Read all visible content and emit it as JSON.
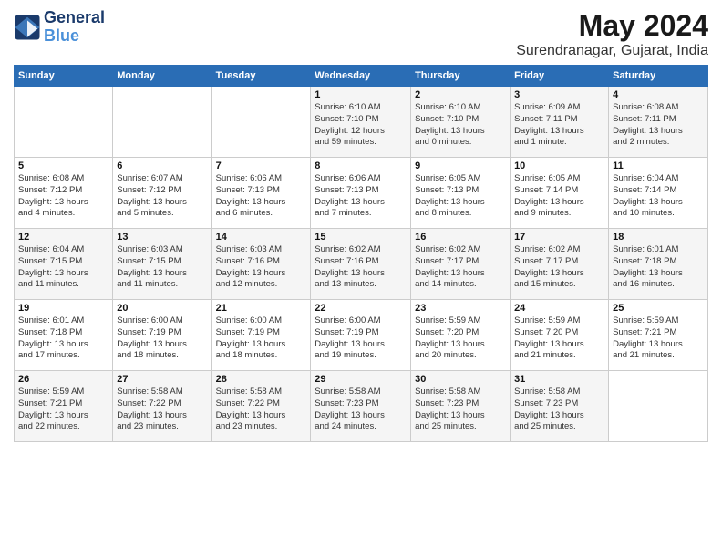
{
  "logo": {
    "line1": "General",
    "line2": "Blue"
  },
  "title": "May 2024",
  "location": "Surendranagar, Gujarat, India",
  "days_header": [
    "Sunday",
    "Monday",
    "Tuesday",
    "Wednesday",
    "Thursday",
    "Friday",
    "Saturday"
  ],
  "weeks": [
    [
      {
        "day": "",
        "info": ""
      },
      {
        "day": "",
        "info": ""
      },
      {
        "day": "",
        "info": ""
      },
      {
        "day": "1",
        "info": "Sunrise: 6:10 AM\nSunset: 7:10 PM\nDaylight: 12 hours\nand 59 minutes."
      },
      {
        "day": "2",
        "info": "Sunrise: 6:10 AM\nSunset: 7:10 PM\nDaylight: 13 hours\nand 0 minutes."
      },
      {
        "day": "3",
        "info": "Sunrise: 6:09 AM\nSunset: 7:11 PM\nDaylight: 13 hours\nand 1 minute."
      },
      {
        "day": "4",
        "info": "Sunrise: 6:08 AM\nSunset: 7:11 PM\nDaylight: 13 hours\nand 2 minutes."
      }
    ],
    [
      {
        "day": "5",
        "info": "Sunrise: 6:08 AM\nSunset: 7:12 PM\nDaylight: 13 hours\nand 4 minutes."
      },
      {
        "day": "6",
        "info": "Sunrise: 6:07 AM\nSunset: 7:12 PM\nDaylight: 13 hours\nand 5 minutes."
      },
      {
        "day": "7",
        "info": "Sunrise: 6:06 AM\nSunset: 7:13 PM\nDaylight: 13 hours\nand 6 minutes."
      },
      {
        "day": "8",
        "info": "Sunrise: 6:06 AM\nSunset: 7:13 PM\nDaylight: 13 hours\nand 7 minutes."
      },
      {
        "day": "9",
        "info": "Sunrise: 6:05 AM\nSunset: 7:13 PM\nDaylight: 13 hours\nand 8 minutes."
      },
      {
        "day": "10",
        "info": "Sunrise: 6:05 AM\nSunset: 7:14 PM\nDaylight: 13 hours\nand 9 minutes."
      },
      {
        "day": "11",
        "info": "Sunrise: 6:04 AM\nSunset: 7:14 PM\nDaylight: 13 hours\nand 10 minutes."
      }
    ],
    [
      {
        "day": "12",
        "info": "Sunrise: 6:04 AM\nSunset: 7:15 PM\nDaylight: 13 hours\nand 11 minutes."
      },
      {
        "day": "13",
        "info": "Sunrise: 6:03 AM\nSunset: 7:15 PM\nDaylight: 13 hours\nand 11 minutes."
      },
      {
        "day": "14",
        "info": "Sunrise: 6:03 AM\nSunset: 7:16 PM\nDaylight: 13 hours\nand 12 minutes."
      },
      {
        "day": "15",
        "info": "Sunrise: 6:02 AM\nSunset: 7:16 PM\nDaylight: 13 hours\nand 13 minutes."
      },
      {
        "day": "16",
        "info": "Sunrise: 6:02 AM\nSunset: 7:17 PM\nDaylight: 13 hours\nand 14 minutes."
      },
      {
        "day": "17",
        "info": "Sunrise: 6:02 AM\nSunset: 7:17 PM\nDaylight: 13 hours\nand 15 minutes."
      },
      {
        "day": "18",
        "info": "Sunrise: 6:01 AM\nSunset: 7:18 PM\nDaylight: 13 hours\nand 16 minutes."
      }
    ],
    [
      {
        "day": "19",
        "info": "Sunrise: 6:01 AM\nSunset: 7:18 PM\nDaylight: 13 hours\nand 17 minutes."
      },
      {
        "day": "20",
        "info": "Sunrise: 6:00 AM\nSunset: 7:19 PM\nDaylight: 13 hours\nand 18 minutes."
      },
      {
        "day": "21",
        "info": "Sunrise: 6:00 AM\nSunset: 7:19 PM\nDaylight: 13 hours\nand 18 minutes."
      },
      {
        "day": "22",
        "info": "Sunrise: 6:00 AM\nSunset: 7:19 PM\nDaylight: 13 hours\nand 19 minutes."
      },
      {
        "day": "23",
        "info": "Sunrise: 5:59 AM\nSunset: 7:20 PM\nDaylight: 13 hours\nand 20 minutes."
      },
      {
        "day": "24",
        "info": "Sunrise: 5:59 AM\nSunset: 7:20 PM\nDaylight: 13 hours\nand 21 minutes."
      },
      {
        "day": "25",
        "info": "Sunrise: 5:59 AM\nSunset: 7:21 PM\nDaylight: 13 hours\nand 21 minutes."
      }
    ],
    [
      {
        "day": "26",
        "info": "Sunrise: 5:59 AM\nSunset: 7:21 PM\nDaylight: 13 hours\nand 22 minutes."
      },
      {
        "day": "27",
        "info": "Sunrise: 5:58 AM\nSunset: 7:22 PM\nDaylight: 13 hours\nand 23 minutes."
      },
      {
        "day": "28",
        "info": "Sunrise: 5:58 AM\nSunset: 7:22 PM\nDaylight: 13 hours\nand 23 minutes."
      },
      {
        "day": "29",
        "info": "Sunrise: 5:58 AM\nSunset: 7:23 PM\nDaylight: 13 hours\nand 24 minutes."
      },
      {
        "day": "30",
        "info": "Sunrise: 5:58 AM\nSunset: 7:23 PM\nDaylight: 13 hours\nand 25 minutes."
      },
      {
        "day": "31",
        "info": "Sunrise: 5:58 AM\nSunset: 7:23 PM\nDaylight: 13 hours\nand 25 minutes."
      },
      {
        "day": "",
        "info": ""
      }
    ]
  ]
}
